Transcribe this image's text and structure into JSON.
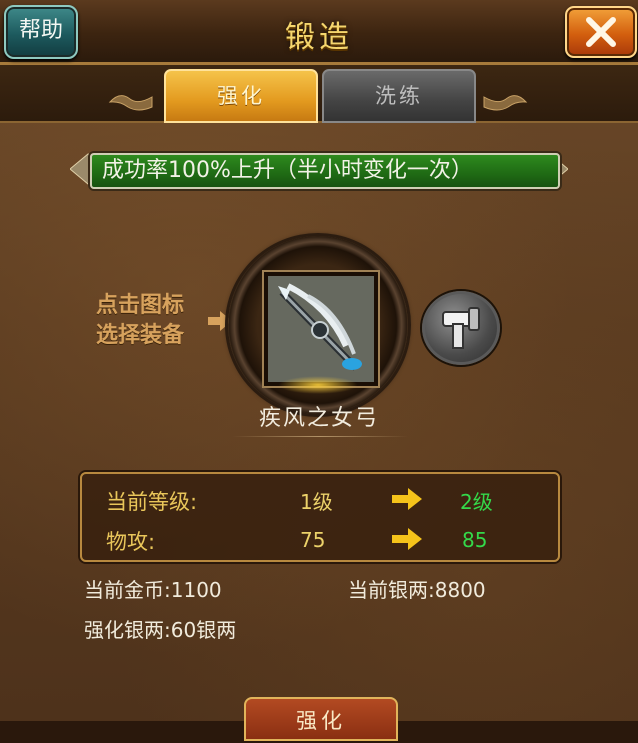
{
  "header": {
    "title": "锻造",
    "help_label": "帮助"
  },
  "tabs": [
    {
      "label": "强化",
      "active": true
    },
    {
      "label": "洗练",
      "active": false
    }
  ],
  "banner": {
    "text": "成功率100%上升（半小时变化一次）"
  },
  "hint": {
    "line1": "点击图标",
    "line2": "选择装备"
  },
  "item": {
    "name": "疾风之女弓",
    "icon": "bow-weapon-icon"
  },
  "stats": {
    "level_label": "当前等级:",
    "level_current": "1级",
    "level_next": "2级",
    "attack_label": "物攻:",
    "attack_current": "75",
    "attack_next": "85"
  },
  "currency": {
    "gold_label": "当前金币:",
    "gold_value": "1100",
    "silver_label": "当前银两:",
    "silver_value": "8800",
    "cost_label": "强化银两:",
    "cost_value": "60银两"
  },
  "action": {
    "label": "强化"
  },
  "colors": {
    "title": "#f5d66d",
    "tab_active": "#e39a1f",
    "banner_green": "#1f6a14",
    "next_value_green": "#34d94a",
    "current_value_yellow": "#ecd26a"
  }
}
